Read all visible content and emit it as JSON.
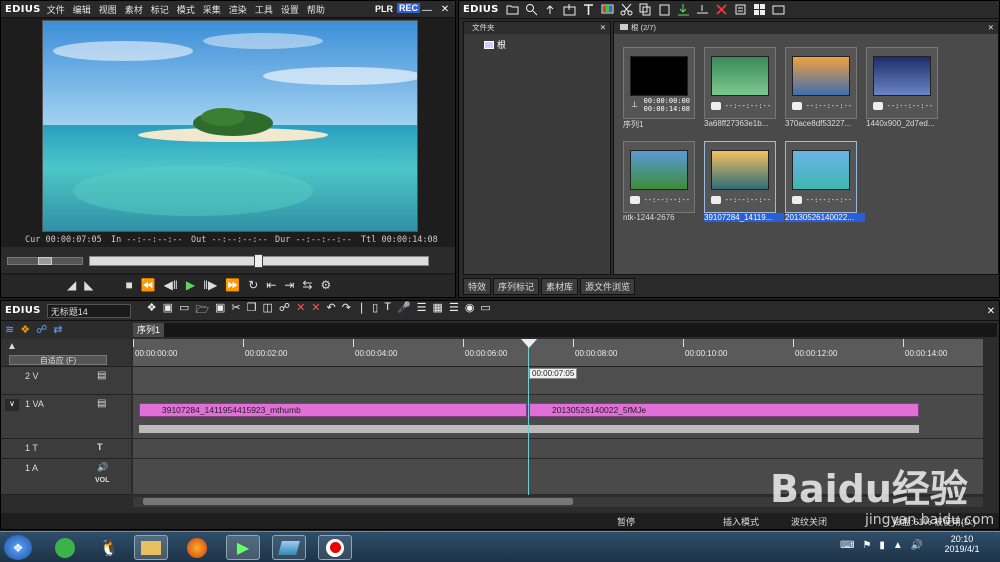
{
  "player": {
    "logo": "EDIUS",
    "menu": [
      "文件",
      "编辑",
      "视图",
      "素材",
      "标记",
      "模式",
      "采集",
      "渲染",
      "工具",
      "设置",
      "帮助"
    ],
    "plr": "PLR",
    "rec": "REC",
    "cur_label": "Cur",
    "cur": "00:00:07:05",
    "in_label": "In",
    "in": "--:--:--:--",
    "out_label": "Out",
    "out": "--:--:--:--",
    "dur_label": "Dur",
    "dur": "--:--:--:--",
    "ttl_label": "Ttl",
    "ttl": "00:00:14:08"
  },
  "bin": {
    "logo": "EDIUS",
    "folder_header": "文件夹",
    "root": "根",
    "path": "根 (2/7)",
    "clips": [
      {
        "name": "序列1",
        "dur": "00:00:00:00",
        "dur2": "00:00:14:08"
      },
      {
        "name": "3a68ff27363e1b...",
        "dur": "--:--:--:--"
      },
      {
        "name": "370ace8df53227...",
        "dur": "--:--:--:--"
      },
      {
        "name": "1440x900_2d7ed...",
        "dur": "--:--:--:--"
      },
      {
        "name": "ntk-1244-2676",
        "dur": "--:--:--:--"
      },
      {
        "name": "39107284_14119...",
        "dur": "--:--:--:--"
      },
      {
        "name": "20130526140022...",
        "dur": "--:--:--:--"
      }
    ],
    "tabs": [
      "特效",
      "序列标记",
      "素材库",
      "源文件浏览"
    ]
  },
  "timeline": {
    "logo": "EDIUS",
    "project": "无标题14",
    "sequence_tab": "序列1",
    "fit": "自适应 (F)",
    "ruler": [
      "00:00:00:00",
      "00:00:02:00",
      "00:00:04:00",
      "00:00:06:00",
      "00:00:08:00",
      "00:00:10:00",
      "00:00:12:00",
      "00:00:14:00"
    ],
    "playhead_tc": "00:00:07:05",
    "tracks": [
      {
        "name": "2 V"
      },
      {
        "name": "1 VA"
      },
      {
        "name": "1 T"
      },
      {
        "name": "1 A"
      }
    ],
    "clip1": "39107284_1411954415923_mthumb",
    "clip2": "20130526140022_5fMJe",
    "vol": "VOL",
    "status": {
      "pause": "暂停",
      "insert": "插入模式",
      "ripple": "波纹关闭",
      "disk": "磁盘:61% 被使用(D:)"
    }
  },
  "taskbar": {
    "time": "20:10",
    "date": "2019/4/1"
  },
  "watermark": {
    "text": "Baidu经验",
    "url": "jingyan.baidu.com"
  }
}
